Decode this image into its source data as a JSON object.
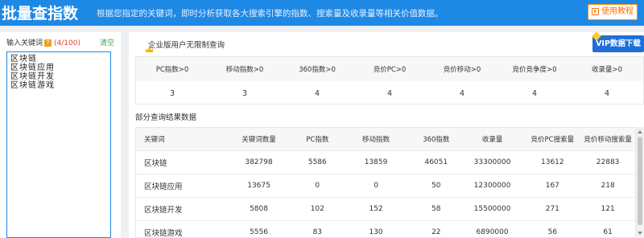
{
  "header": {
    "title": "批量查指数",
    "description": "根据您指定的关键词，即时分析获取各大搜索引擎的指数、搜索量及收录量等相关价值数据。",
    "tutorial_label": "使用教程"
  },
  "left": {
    "label": "输入关键词",
    "help_icon": "?",
    "count": "(4/100)",
    "clear_label": "清空",
    "keywords": [
      "区块链",
      "区块链应用",
      "区块链开发",
      "区块链游戏"
    ]
  },
  "main": {
    "enterprise_text": "企业版用户无限制查询",
    "vip_button": "VIP数据下载",
    "stats": {
      "headers": [
        "PC指数>0",
        "移动指数>0",
        "360指数>0",
        "竞价PC>0",
        "竞价移动>0",
        "竞价竞争度>0",
        "收录量>0"
      ],
      "values": [
        "3",
        "3",
        "4",
        "4",
        "4",
        "4",
        "4"
      ]
    },
    "section_title": "部分查询结果数据",
    "table": {
      "columns": [
        "关键词",
        "关键词数量",
        "PC指数",
        "移动指数",
        "360指数",
        "收录量",
        "竞价PC搜索量",
        "竞价移动搜索量"
      ],
      "rows": [
        [
          "区块链",
          "382798",
          "5586",
          "13859",
          "46051",
          "33300000",
          "13612",
          "22883"
        ],
        [
          "区块链应用",
          "13675",
          "0",
          "0",
          "50",
          "12300000",
          "167",
          "218"
        ],
        [
          "区块链开发",
          "5808",
          "102",
          "152",
          "58",
          "15500000",
          "271",
          "121"
        ],
        [
          "区块链游戏",
          "5556",
          "83",
          "130",
          "22",
          "6890000",
          "56",
          "61"
        ]
      ]
    }
  }
}
